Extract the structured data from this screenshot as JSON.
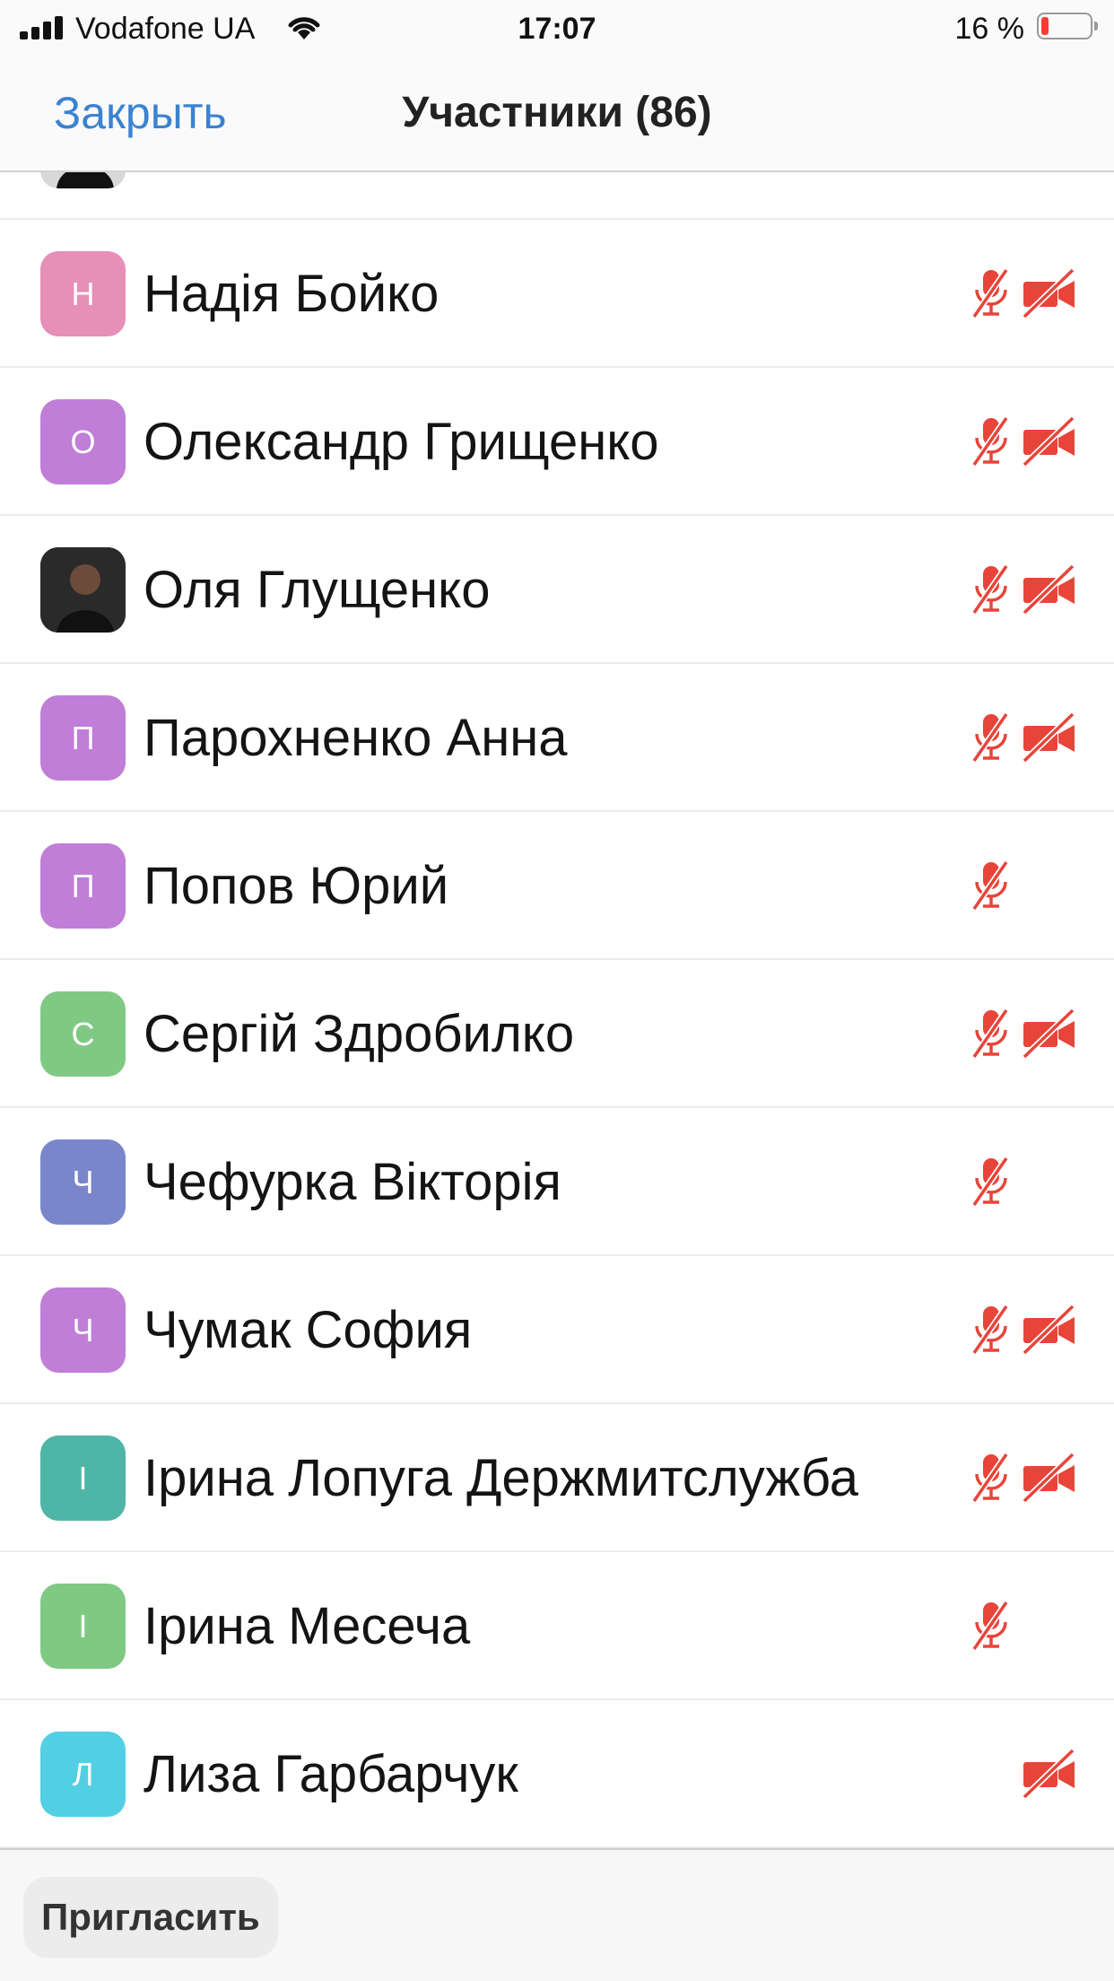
{
  "status_bar": {
    "carrier": "Vodafone UA",
    "time": "17:07",
    "battery_text": "16 %",
    "battery_level": 0.16
  },
  "nav": {
    "close_label": "Закрыть",
    "title": "Участники (86)"
  },
  "participants": [
    {
      "name": "",
      "initial": "",
      "avatar_color": "#d8d8d8",
      "photo": true,
      "mic_muted": true,
      "video_off": true,
      "partial": true
    },
    {
      "name": "Надія Бойко",
      "initial": "Н",
      "avatar_color": "#e68fb8",
      "mic_muted": true,
      "video_off": true
    },
    {
      "name": "Олександр Грищенко",
      "initial": "О",
      "avatar_color": "#c07ed8",
      "mic_muted": true,
      "video_off": true
    },
    {
      "name": "Оля Глущенко",
      "initial": "",
      "avatar_color": "#2a2a2a",
      "photo": true,
      "mic_muted": true,
      "video_off": true
    },
    {
      "name": "Парохненко Анна",
      "initial": "П",
      "avatar_color": "#c07ed8",
      "mic_muted": true,
      "video_off": true
    },
    {
      "name": "Попов Юрий",
      "initial": "П",
      "avatar_color": "#c07ed8",
      "mic_muted": true,
      "video_off": false
    },
    {
      "name": "Сергій Здробилко",
      "initial": "С",
      "avatar_color": "#80c984",
      "mic_muted": true,
      "video_off": true
    },
    {
      "name": "Чефурка Вікторія",
      "initial": "Ч",
      "avatar_color": "#7a86cc",
      "mic_muted": true,
      "video_off": false
    },
    {
      "name": "Чумак София",
      "initial": "Ч",
      "avatar_color": "#c07ed8",
      "mic_muted": true,
      "video_off": true
    },
    {
      "name": "Ірина Лопуга Держмитслужба",
      "initial": "І",
      "avatar_color": "#4fb5a6",
      "mic_muted": true,
      "video_off": true
    },
    {
      "name": "Ірина Месеча",
      "initial": "І",
      "avatar_color": "#80c984",
      "mic_muted": true,
      "video_off": false
    },
    {
      "name": "Лиза Гарбарчук",
      "initial": "Л",
      "avatar_color": "#52cfe3",
      "mic_muted": false,
      "video_off": true
    }
  ],
  "bottom": {
    "invite_label": "Пригласить"
  },
  "colors": {
    "accent": "#3b82d1",
    "muted_red": "#e8443a"
  },
  "icons": [
    "signal-icon",
    "wifi-icon",
    "battery-icon",
    "mic-muted-icon",
    "video-off-icon"
  ]
}
